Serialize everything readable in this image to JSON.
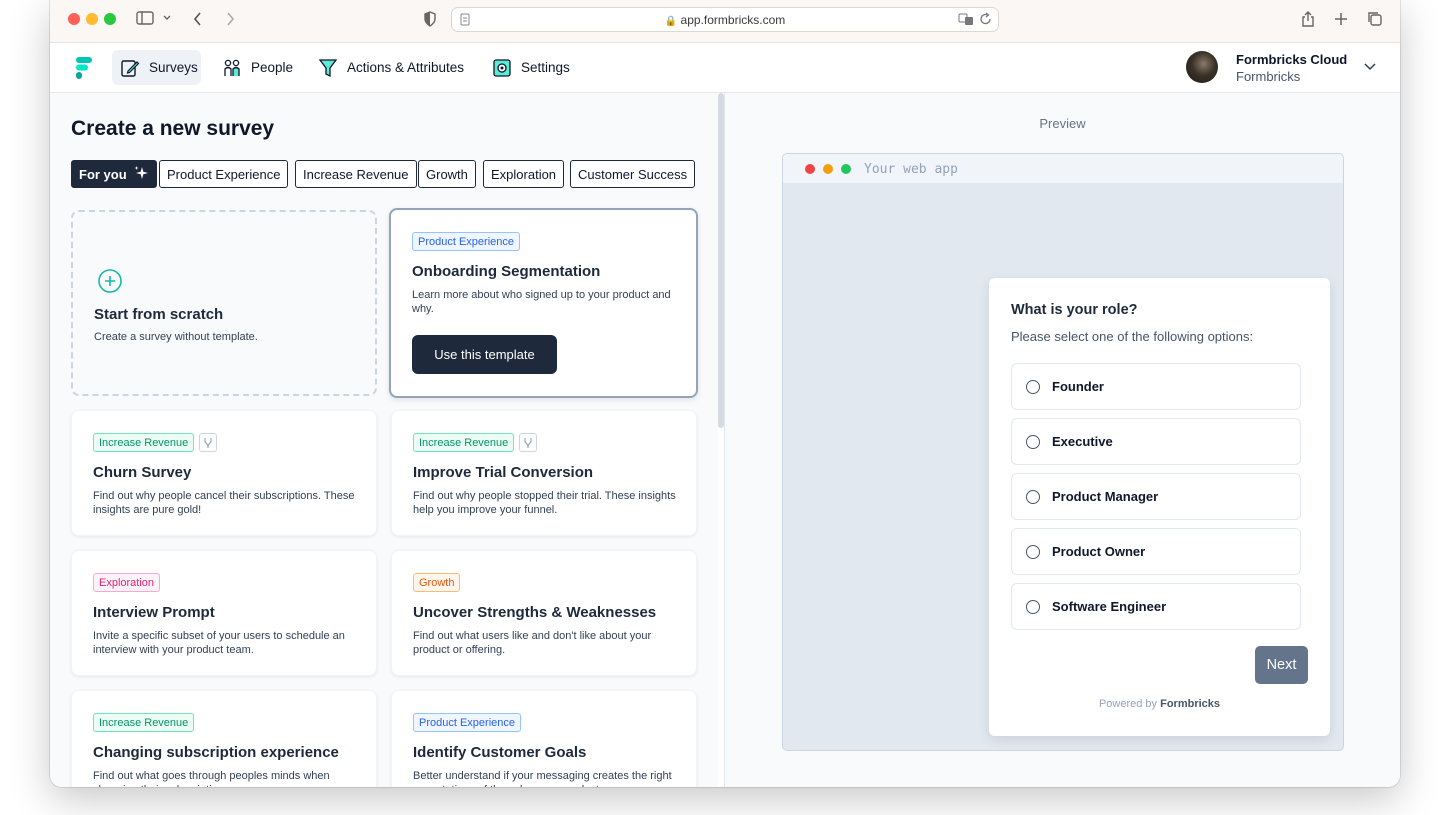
{
  "browser": {
    "url": "app.formbricks.com"
  },
  "nav": {
    "items": [
      {
        "label": "Surveys",
        "active": true
      },
      {
        "label": "People"
      },
      {
        "label": "Actions & Attributes"
      },
      {
        "label": "Settings"
      }
    ],
    "profile": {
      "name": "Formbricks Cloud",
      "org": "Formbricks"
    }
  },
  "main": {
    "title": "Create a new survey",
    "filters": [
      "For you",
      "Product Experience",
      "Increase Revenue",
      "Growth",
      "Exploration",
      "Customer Success"
    ],
    "scratch": {
      "title": "Start from scratch",
      "desc": "Create a survey without template."
    },
    "templates": [
      {
        "tag": "Product Experience",
        "title": "Onboarding Segmentation",
        "desc": "Learn more about who signed up to your product and why.",
        "button": "Use this template"
      },
      {
        "tag": "Increase Revenue",
        "title": "Churn Survey",
        "desc": "Find out why people cancel their subscriptions. These insights are pure gold!"
      },
      {
        "tag": "Increase Revenue",
        "title": "Improve Trial Conversion",
        "desc": "Find out why people stopped their trial. These insights help you improve your funnel."
      },
      {
        "tag": "Exploration",
        "title": "Interview Prompt",
        "desc": "Invite a specific subset of your users to schedule an interview with your product team."
      },
      {
        "tag": "Growth",
        "title": "Uncover Strengths & Weaknesses",
        "desc": "Find out what users like and don't like about your product or offering."
      },
      {
        "tag": "Increase Revenue",
        "title": "Changing subscription experience",
        "desc": "Find out what goes through peoples minds when changing their subscriptions."
      },
      {
        "tag": "Product Experience",
        "title": "Identify Customer Goals",
        "desc": "Better understand if your messaging creates the right expectations of the value your product."
      }
    ]
  },
  "preview": {
    "label": "Preview",
    "mock_title": "Your web app",
    "question": "What is your role?",
    "subheader": "Please select one of the following options:",
    "options": [
      "Founder",
      "Executive",
      "Product Manager",
      "Product Owner",
      "Software Engineer"
    ],
    "next": "Next",
    "powered_prefix": "Powered by",
    "powered_brand": "Formbricks"
  },
  "colors": {
    "brand": "#00c4b8",
    "dark": "#1e293b",
    "tag_product_experience": "#2563eb",
    "tag_increase_revenue": "#059669",
    "tag_exploration": "#db2777",
    "tag_growth": "#ea580c"
  }
}
